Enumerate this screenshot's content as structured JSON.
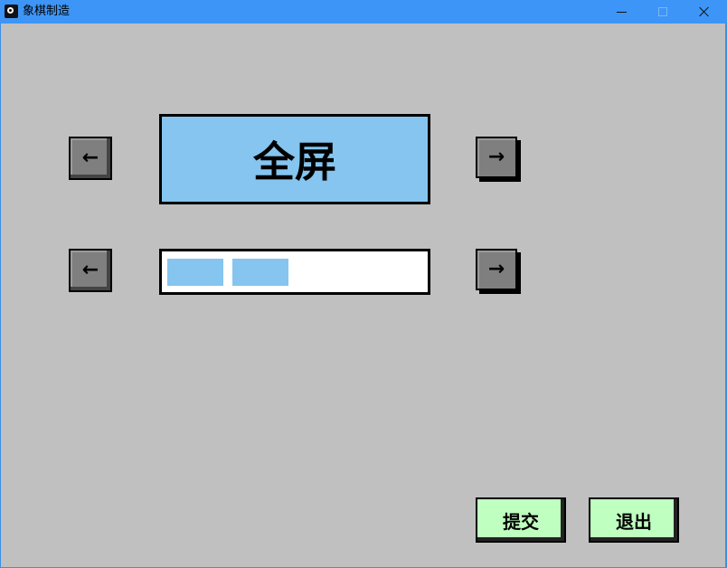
{
  "window": {
    "title": "象棋制造",
    "controls": {
      "minimize": "minimize-icon",
      "maximize": "maximize-icon",
      "close": "close-icon"
    }
  },
  "settings": {
    "display_mode": {
      "value": "全屏",
      "prev_icon": "arrow-left-icon",
      "next_icon": "arrow-right-icon",
      "prev_glyph": "←",
      "next_glyph": "→"
    },
    "level": {
      "filled_segments": 2,
      "prev_glyph": "←",
      "next_glyph": "→"
    }
  },
  "actions": {
    "submit_label": "提交",
    "exit_label": "退出"
  },
  "colors": {
    "background": "#c0c0c0",
    "accent_blue": "#85c5ef",
    "button_green": "#bfffc0",
    "arrow_button": "#7f7f7f",
    "titlebar": "#3d95f7"
  }
}
